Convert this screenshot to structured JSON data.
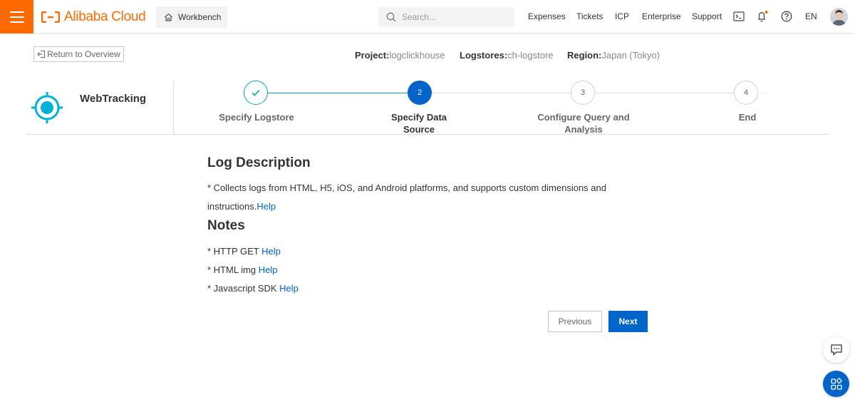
{
  "topbar": {
    "menu_icon": "hamburger-icon",
    "brand": "Alibaba Cloud",
    "workbench": "Workbench",
    "search_placeholder": "Search...",
    "nav": [
      "Expenses",
      "Tickets",
      "ICP",
      "Enterprise",
      "Support"
    ],
    "icons": [
      "terminal-icon",
      "bell-icon",
      "help-icon"
    ],
    "language": "EN",
    "colors": {
      "brand": "#ff6a00",
      "notification_dot": "#ff6a00"
    }
  },
  "header": {
    "return_label": "Return to Overview",
    "project_label": "Project:",
    "project_value": "logclickhouse",
    "logstores_label": "Logstores:",
    "logstores_value": "ch-logstore",
    "region_label": "Region:",
    "region_value": "Japan (Tokyo)"
  },
  "wizard": {
    "title": "WebTracking",
    "steps": [
      {
        "num": "1",
        "label": "Specify Logstore",
        "state": "done"
      },
      {
        "num": "2",
        "label": "Specify Data Source",
        "state": "active"
      },
      {
        "num": "3",
        "label": "Configure Query and Analysis",
        "state": "pending"
      },
      {
        "num": "4",
        "label": "End",
        "state": "pending"
      }
    ],
    "colors": {
      "accent": "#0064c8",
      "done": "#00a4c7"
    }
  },
  "content": {
    "description_title": "Log Description",
    "description_line1": "* Collects logs from HTML, H5, iOS, and Android platforms, and supports custom dimensions and",
    "description_line2": "instructions.",
    "description_help": "Help",
    "notes_title": "Notes",
    "notes": [
      {
        "text": "* HTTP GET ",
        "help": "Help"
      },
      {
        "text": "* HTML img ",
        "help": "Help"
      },
      {
        "text": "* Javascript SDK ",
        "help": "Help"
      }
    ]
  },
  "actions": {
    "previous": "Previous",
    "next": "Next"
  },
  "floating": [
    "chat-icon",
    "apps-icon"
  ]
}
